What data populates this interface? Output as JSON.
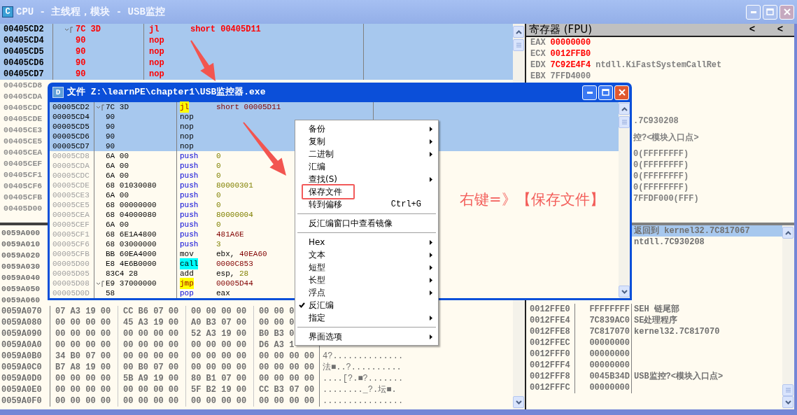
{
  "window": {
    "icon_letter": "C",
    "title": "CPU - 主线程，模块 - USB监控"
  },
  "disassembly": {
    "rows": [
      {
        "address": "00405CD2",
        "hex": "7C 3D",
        "fold": true,
        "mnemonic": "jl",
        "operand": "short 00405D11",
        "modified": true,
        "selected": true
      },
      {
        "address": "00405CD4",
        "hex": "90",
        "fold": false,
        "mnemonic": "nop",
        "modified": true,
        "selected": true
      },
      {
        "address": "00405CD5",
        "hex": "90",
        "fold": false,
        "mnemonic": "nop",
        "modified": true,
        "selected": true
      },
      {
        "address": "00405CD6",
        "hex": "90",
        "fold": false,
        "mnemonic": "nop",
        "modified": true,
        "selected": true
      },
      {
        "address": "00405CD7",
        "hex": "90",
        "fold": false,
        "mnemonic": "nop",
        "modified": true,
        "selected": true
      }
    ],
    "covered_rows": [
      {
        "address": "00405CD8",
        "selected": false
      },
      {
        "address": "00405CDA",
        "selected": false
      },
      {
        "address": "00405CDC",
        "selected": false
      },
      {
        "address": "00405CDE",
        "selected": false
      },
      {
        "address": "00405CE3",
        "selected": false
      },
      {
        "address": "00405CE5",
        "selected": false
      },
      {
        "address": "00405CEA",
        "selected": false
      },
      {
        "address": "00405CEF",
        "selected": false
      },
      {
        "address": "00405CF1",
        "selected": false
      },
      {
        "address": "00405CF6",
        "selected": false
      },
      {
        "address": "00405CFB",
        "selected": false
      },
      {
        "address": "00405D00",
        "selected": false
      }
    ]
  },
  "hex_dump": {
    "rows": [
      {
        "address": "0059A000"
      },
      {
        "address": "0059A010"
      },
      {
        "address": "0059A020"
      },
      {
        "address": "0059A030"
      },
      {
        "address": "0059A040"
      },
      {
        "address": "0059A050"
      },
      {
        "address": "0059A060"
      },
      {
        "address": "0059A070",
        "bytes": [
          "07 A3 19 00",
          "CC B6 07 00",
          "00 00 00 00",
          "00 00 0"
        ]
      },
      {
        "address": "0059A080",
        "bytes": [
          "00 00 00 00",
          "45 A3 19 00",
          "A0 B3 07 00",
          "00 00 0"
        ]
      },
      {
        "address": "0059A090",
        "bytes": [
          "00 00 00 00",
          "00 00 00 00",
          "52 A3 19 00",
          "B0 B3 0"
        ]
      },
      {
        "address": "0059A0A0",
        "bytes": [
          "00 00 00 00",
          "00 00 00 00",
          "00 00 00 00",
          "D6 A3 1"
        ]
      },
      {
        "address": "0059A0B0",
        "bytes": [
          "34 B0 07 00",
          "00 00 00 00",
          "00 00 00 00",
          "00 00 00 00"
        ],
        "ascii": "4?.............."
      },
      {
        "address": "0059A0C0",
        "bytes": [
          "B7 A8 19 00",
          "00 B0 07 00",
          "00 00 00 00",
          "00 00 00 00"
        ],
        "ascii": "法■..?.........."
      },
      {
        "address": "0059A0D0",
        "bytes": [
          "00 00 00 00",
          "5B A9 19 00",
          "80 B1 07 00",
          "00 00 00 00"
        ],
        "ascii": "....[?.■?......."
      },
      {
        "address": "0059A0E0",
        "bytes": [
          "00 00 00 00",
          "00 00 00 00",
          "5F B2 19 00",
          "CC B3 07 00"
        ],
        "ascii": "........_?.坛■."
      },
      {
        "address": "0059A0F0",
        "bytes": [
          "00 00 00 00",
          "00 00 00 00",
          "00 00 00 00",
          "00 00 00 00"
        ],
        "ascii": "................"
      }
    ]
  },
  "registers": {
    "title": "寄存器 (FPU)",
    "header_buttons": [
      "<",
      "<"
    ],
    "rows": [
      {
        "name": "EAX",
        "value": "00000000",
        "changed": true
      },
      {
        "name": "ECX",
        "value": "0012FFB0",
        "changed": true
      },
      {
        "name": "EDX",
        "value": "7C92E4F4",
        "changed": true,
        "comment": "ntdll.KiFastSystemCallRet"
      },
      {
        "name": "EBX",
        "value": "7FFD4000",
        "changed": false
      }
    ],
    "covered_rows": [
      ".7C930208",
      "控?<模块入口点>",
      "0(FFFFFFFF)",
      "0(FFFFFFFF)",
      "0(FFFFFFFF)",
      "0(FFFFFFFF)",
      "7FFDF000(FFF)"
    ]
  },
  "stack": {
    "top_rows": [
      {
        "comment": "返回到 kernel32.7C817067",
        "selected": true
      },
      {
        "comment": "ntdll.7C930208",
        "selected": false
      }
    ],
    "rows": [
      {
        "address": "0012FFE0",
        "value": "FFFFFFFF",
        "comment": "SEH 链尾部"
      },
      {
        "address": "0012FFE4",
        "value": "7C839AC0",
        "comment": "SE处理程序"
      },
      {
        "address": "0012FFE8",
        "value": "7C817070",
        "comment": "kernel32.7C817070"
      },
      {
        "address": "0012FFEC",
        "value": "00000000"
      },
      {
        "address": "0012FFF0",
        "value": "00000000"
      },
      {
        "address": "0012FFF4",
        "value": "00000000"
      },
      {
        "address": "0012FFF8",
        "value": "0045B34D",
        "comment": "USB监控?<模块入口点>"
      },
      {
        "address": "0012FFFC",
        "value": "00000000"
      }
    ]
  },
  "file_window": {
    "icon_letter": "D",
    "title": "文件 Z:\\learnPE\\chapter1\\USB监控器.exe",
    "rows": [
      {
        "address": "00005CD2",
        "hex": "7C 3D",
        "fold": true,
        "kind": "jump",
        "mnemonic": "jl",
        "operands": [
          {
            "text": "short 00005D11",
            "kind": "address"
          }
        ],
        "selected": true
      },
      {
        "address": "00005CD4",
        "hex": "90",
        "fold": false,
        "kind": "plain",
        "mnemonic": "nop",
        "selected": true
      },
      {
        "address": "00005CD5",
        "hex": "90",
        "fold": false,
        "kind": "plain",
        "mnemonic": "nop",
        "selected": true
      },
      {
        "address": "00005CD6",
        "hex": "90",
        "fold": false,
        "kind": "plain",
        "mnemonic": "nop",
        "selected": true
      },
      {
        "address": "00005CD7",
        "hex": "90",
        "fold": false,
        "kind": "plain",
        "mnemonic": "nop",
        "selected": true
      },
      {
        "address": "00005CD8",
        "hex": "6A 00",
        "fold": false,
        "kind": "stack",
        "mnemonic": "push",
        "operands": [
          {
            "text": "0",
            "kind": "const"
          }
        ],
        "selected": false
      },
      {
        "address": "00005CDA",
        "hex": "6A 00",
        "fold": false,
        "kind": "stack",
        "mnemonic": "push",
        "operands": [
          {
            "text": "0",
            "kind": "const"
          }
        ],
        "selected": false
      },
      {
        "address": "00005CDC",
        "hex": "6A 00",
        "fold": false,
        "kind": "stack",
        "mnemonic": "push",
        "operands": [
          {
            "text": "0",
            "kind": "const"
          }
        ],
        "selected": false
      },
      {
        "address": "00005CDE",
        "hex": "68 01030080",
        "fold": false,
        "kind": "stack",
        "mnemonic": "push",
        "operands": [
          {
            "text": "80000301",
            "kind": "const"
          }
        ],
        "selected": false
      },
      {
        "address": "00005CE3",
        "hex": "6A 00",
        "fold": false,
        "kind": "stack",
        "mnemonic": "push",
        "operands": [
          {
            "text": "0",
            "kind": "const"
          }
        ],
        "selected": false
      },
      {
        "address": "00005CE5",
        "hex": "68 00000000",
        "fold": false,
        "kind": "stack",
        "mnemonic": "push",
        "operands": [
          {
            "text": "0",
            "kind": "const"
          }
        ],
        "selected": false
      },
      {
        "address": "00005CEA",
        "hex": "68 04000080",
        "fold": false,
        "kind": "stack",
        "mnemonic": "push",
        "operands": [
          {
            "text": "80000004",
            "kind": "const"
          }
        ],
        "selected": false
      },
      {
        "address": "00005CEF",
        "hex": "6A 00",
        "fold": false,
        "kind": "stack",
        "mnemonic": "push",
        "operands": [
          {
            "text": "0",
            "kind": "const"
          }
        ],
        "selected": false
      },
      {
        "address": "00005CF1",
        "hex": "68 6E1A4800",
        "fold": false,
        "kind": "stack",
        "mnemonic": "push",
        "operands": [
          {
            "text": "481A6E",
            "kind": "address"
          }
        ],
        "selected": false
      },
      {
        "address": "00005CF6",
        "hex": "68 03000000",
        "fold": false,
        "kind": "stack",
        "mnemonic": "push",
        "operands": [
          {
            "text": "3",
            "kind": "const"
          }
        ],
        "selected": false
      },
      {
        "address": "00005CFB",
        "hex": "BB 60EA4000",
        "fold": false,
        "kind": "plain",
        "mnemonic": "mov",
        "operands": [
          {
            "text": "ebx, ",
            "kind": "plain"
          },
          {
            "text": "40EA60",
            "kind": "address"
          }
        ],
        "selected": false
      },
      {
        "address": "00005D00",
        "hex": "E8 4E6B0000",
        "fold": false,
        "kind": "call",
        "mnemonic": "call",
        "operands": [
          {
            "text": "0000C853",
            "kind": "address"
          }
        ],
        "selected": false
      },
      {
        "address": "00005D05",
        "hex": "83C4 28",
        "fold": false,
        "kind": "plain",
        "mnemonic": "add",
        "operands": [
          {
            "text": "esp, ",
            "kind": "plain"
          },
          {
            "text": "28",
            "kind": "const"
          }
        ],
        "selected": false
      },
      {
        "address": "00005D08",
        "hex": "E9 37000000",
        "fold": true,
        "kind": "jump",
        "mnemonic": "jmp",
        "operands": [
          {
            "text": "00005D44",
            "kind": "address"
          }
        ],
        "selected": false
      },
      {
        "address": "00005D0D",
        "hex": "58",
        "fold": false,
        "kind": "stack",
        "mnemonic": "pop",
        "operands": [
          {
            "text": "eax",
            "kind": "plain"
          }
        ],
        "selected": false
      }
    ],
    "annotation": "右键=》【保存文件】"
  },
  "context_menu": {
    "items": [
      {
        "kind": "item",
        "label": "备份",
        "submenu": true,
        "checked": false,
        "marked": false
      },
      {
        "kind": "item",
        "label": "复制",
        "submenu": true,
        "checked": false,
        "marked": false
      },
      {
        "kind": "item",
        "label": "二进制",
        "submenu": true,
        "checked": false,
        "marked": false
      },
      {
        "kind": "item",
        "label": "汇编",
        "submenu": false,
        "checked": false,
        "marked": false
      },
      {
        "kind": "item",
        "label": "查找(S)",
        "submenu": true,
        "checked": false,
        "marked": false
      },
      {
        "kind": "item",
        "label": "保存文件",
        "submenu": false,
        "checked": false,
        "marked": true
      },
      {
        "kind": "item",
        "label": "转到偏移",
        "shortcut": "Ctrl+G",
        "submenu": false,
        "checked": false,
        "marked": false
      },
      {
        "kind": "separator"
      },
      {
        "kind": "item",
        "label": "反汇编窗口中查看镜像",
        "submenu": false,
        "checked": false,
        "marked": false
      },
      {
        "kind": "separator"
      },
      {
        "kind": "item",
        "label": "Hex",
        "submenu": true,
        "checked": false,
        "marked": false
      },
      {
        "kind": "item",
        "label": "文本",
        "submenu": true,
        "checked": false,
        "marked": false
      },
      {
        "kind": "item",
        "label": "短型",
        "submenu": true,
        "checked": false,
        "marked": false
      },
      {
        "kind": "item",
        "label": "长型",
        "submenu": true,
        "checked": false,
        "marked": false
      },
      {
        "kind": "item",
        "label": "浮点",
        "submenu": true,
        "checked": false,
        "marked": false
      },
      {
        "kind": "item",
        "label": "反汇编",
        "submenu": false,
        "checked": true,
        "marked": false
      },
      {
        "kind": "item",
        "label": "指定",
        "submenu": true,
        "checked": false,
        "marked": false
      },
      {
        "kind": "separator"
      },
      {
        "kind": "item",
        "label": "界面选项",
        "submenu": true,
        "checked": false,
        "marked": false
      }
    ]
  }
}
